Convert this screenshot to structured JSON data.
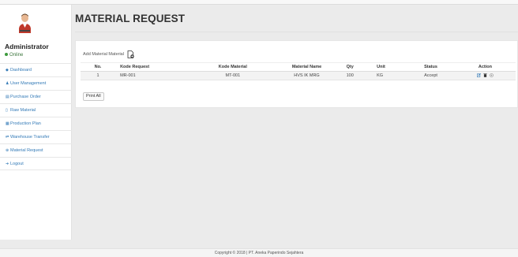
{
  "sidebar": {
    "user_name": "Administrator",
    "status": "Online",
    "status_color": "#3c9a3c",
    "items": [
      {
        "icon": "dashboard-icon",
        "label": "Dashboard"
      },
      {
        "icon": "user-icon",
        "label": "User Management"
      },
      {
        "icon": "purchase-order-icon",
        "label": "Purchase Order"
      },
      {
        "icon": "raw-material-icon",
        "label": "Raw Material"
      },
      {
        "icon": "calendar-icon",
        "label": "Production Plan"
      },
      {
        "icon": "transfer-icon",
        "label": "Warehouse Transfer"
      },
      {
        "icon": "request-icon",
        "label": "Material Request"
      },
      {
        "icon": "logout-icon",
        "label": "Logout"
      }
    ]
  },
  "main": {
    "title": "MATERIAL REQUEST",
    "add_label": "Add Material Material",
    "print_label": "Print All",
    "table": {
      "headers": [
        "No.",
        "Kode Request",
        "Kode Material",
        "Material Name",
        "Qty",
        "Unit",
        "Status",
        "Action"
      ],
      "rows": [
        [
          "1",
          "MR-001",
          "MT-001",
          "HVS IK MRG",
          "100",
          "KG",
          "Accept"
        ]
      ]
    }
  },
  "footer": {
    "text": "Copyright © 2018 | PT. Aneka Paperindo Sejahtera"
  },
  "colors": {
    "link": "#337ab7",
    "background": "#ebebeb"
  }
}
